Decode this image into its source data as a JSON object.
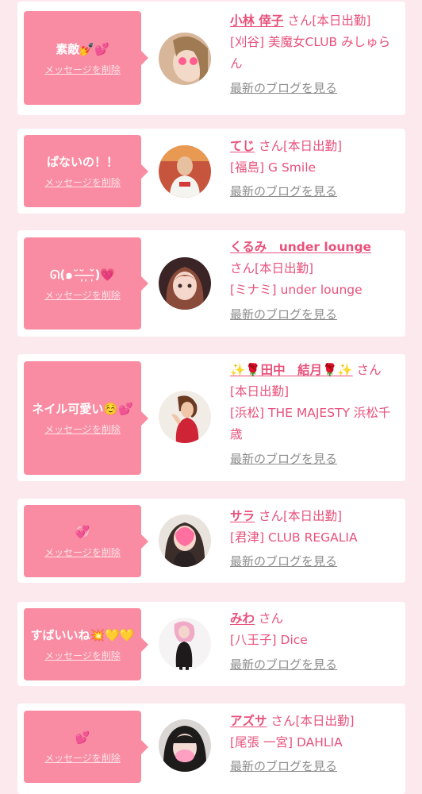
{
  "theme": {
    "background": "#fbe9ee",
    "card": "#ffffff",
    "bubble": "#f98ca2",
    "accent": "#e8517b",
    "muted": "#8c8c8c"
  },
  "items": [
    {
      "message": "素敵",
      "emoji": "💅💕",
      "delete_label": "メッセージを削除",
      "name": "小林 倖子",
      "status": "さん[本日出勤]",
      "shop": "[刈谷] 美魔女CLUB みしゅらん",
      "blog_label": "最新のブログを見る",
      "avatar": "avatar-photo-woman-heart-eyes"
    },
    {
      "message": "ぱないの！！",
      "emoji": "",
      "delete_label": "メッセージを削除",
      "name": "てじ",
      "status": "さん[本日出勤]",
      "shop": "[福島] G Smile",
      "blog_label": "最新のブログを見る",
      "avatar": "avatar-photo-person-shirt"
    },
    {
      "message": "ᘏ(๑˘˘̶̩ ̶̩ˇ̶̩)",
      "emoji": "💗",
      "delete_label": "メッセージを削除",
      "name": "くるみ　under lounge",
      "status": "さん[本日出勤]",
      "shop": "[ミナミ] under lounge",
      "blog_label": "最新のブログを見る",
      "avatar": "avatar-photo-woman-pink"
    },
    {
      "message": "ネイル可愛い",
      "emoji": "☺️💕",
      "delete_label": "メッセージを削除",
      "name": "✨🌹田中　結月🌹✨",
      "status": "さん[本日出勤]",
      "shop": "[浜松] THE MAJESTY 浜松千歳",
      "blog_label": "最新のブログを見る",
      "avatar": "avatar-photo-woman-red-dress"
    },
    {
      "message": "",
      "emoji": "💞",
      "delete_label": "メッセージを削除",
      "name": "サラ",
      "status": "さん[本日出勤]",
      "shop": "[君津] CLUB REGALIA",
      "blog_label": "最新のブログを見る",
      "avatar": "avatar-photo-woman-heart-mask"
    },
    {
      "message": "すばいいね",
      "emoji": "💥💛💛",
      "delete_label": "メッセージを削除",
      "name": "みわ",
      "status": "さん",
      "shop": "[八王子] Dice",
      "blog_label": "最新のブログを見る",
      "avatar": "avatar-photo-woman-black-dress"
    },
    {
      "message": "",
      "emoji": "💕",
      "delete_label": "メッセージを削除",
      "name": "アズサ",
      "status": "さん[本日出勤]",
      "shop": "[尾張 一宮] DAHLIA",
      "blog_label": "最新のブログを見る",
      "avatar": "avatar-photo-woman-blurred"
    }
  ]
}
